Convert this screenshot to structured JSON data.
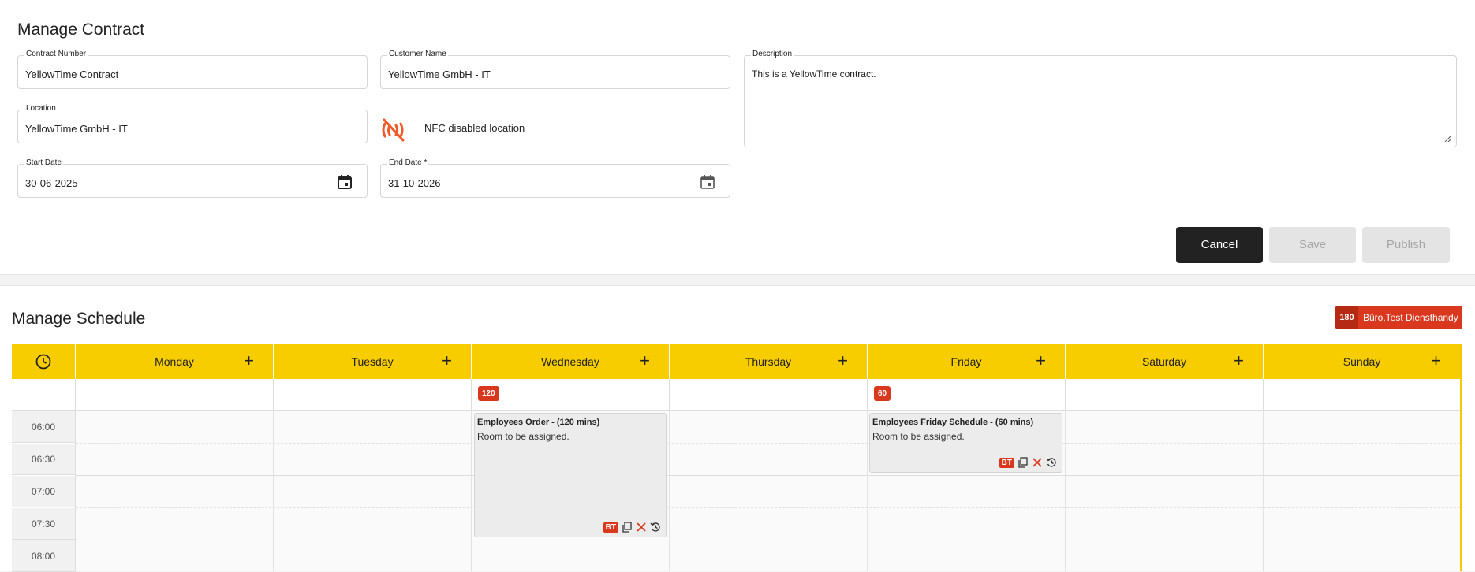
{
  "contract": {
    "title": "Manage Contract",
    "contract_number": {
      "label": "Contract Number",
      "value": "YellowTime Contract"
    },
    "customer_name": {
      "label": "Customer Name",
      "value": "YellowTime GmbH - IT"
    },
    "description": {
      "label": "Description",
      "value": "This is a YellowTime contract."
    },
    "location": {
      "label": "Location",
      "value": "YellowTime GmbH - IT"
    },
    "nfc": {
      "icon": "nfc-off-icon",
      "text": "NFC disabled location",
      "color": "#f05a28"
    },
    "start_date": {
      "label": "Start Date",
      "value": "30-06-2025"
    },
    "end_date": {
      "label": "End Date *",
      "value": "31-10-2026"
    },
    "buttons": {
      "cancel": "Cancel",
      "save": "Save",
      "publish": "Publish"
    }
  },
  "schedule": {
    "title": "Manage Schedule",
    "total_badge": {
      "count": "180",
      "label": "Büro,Test Diensthandy"
    },
    "days": [
      "Monday",
      "Tuesday",
      "Wednesday",
      "Thursday",
      "Friday",
      "Saturday",
      "Sunday"
    ],
    "day_counts": {
      "Wednesday": "120",
      "Friday": "60"
    },
    "times": [
      "06:00",
      "06:30",
      "07:00",
      "07:30",
      "08:00"
    ],
    "events": [
      {
        "day": "Wednesday",
        "title": "Employees Order - (120 mins)",
        "subtitle": "Room to be assigned.",
        "badge": "BT"
      },
      {
        "day": "Friday",
        "title": "Employees Friday Schedule - (60 mins)",
        "subtitle": "Room to be assigned.",
        "badge": "BT"
      }
    ],
    "colors": {
      "header": "#f7cd00",
      "badge": "#d9381e"
    }
  }
}
